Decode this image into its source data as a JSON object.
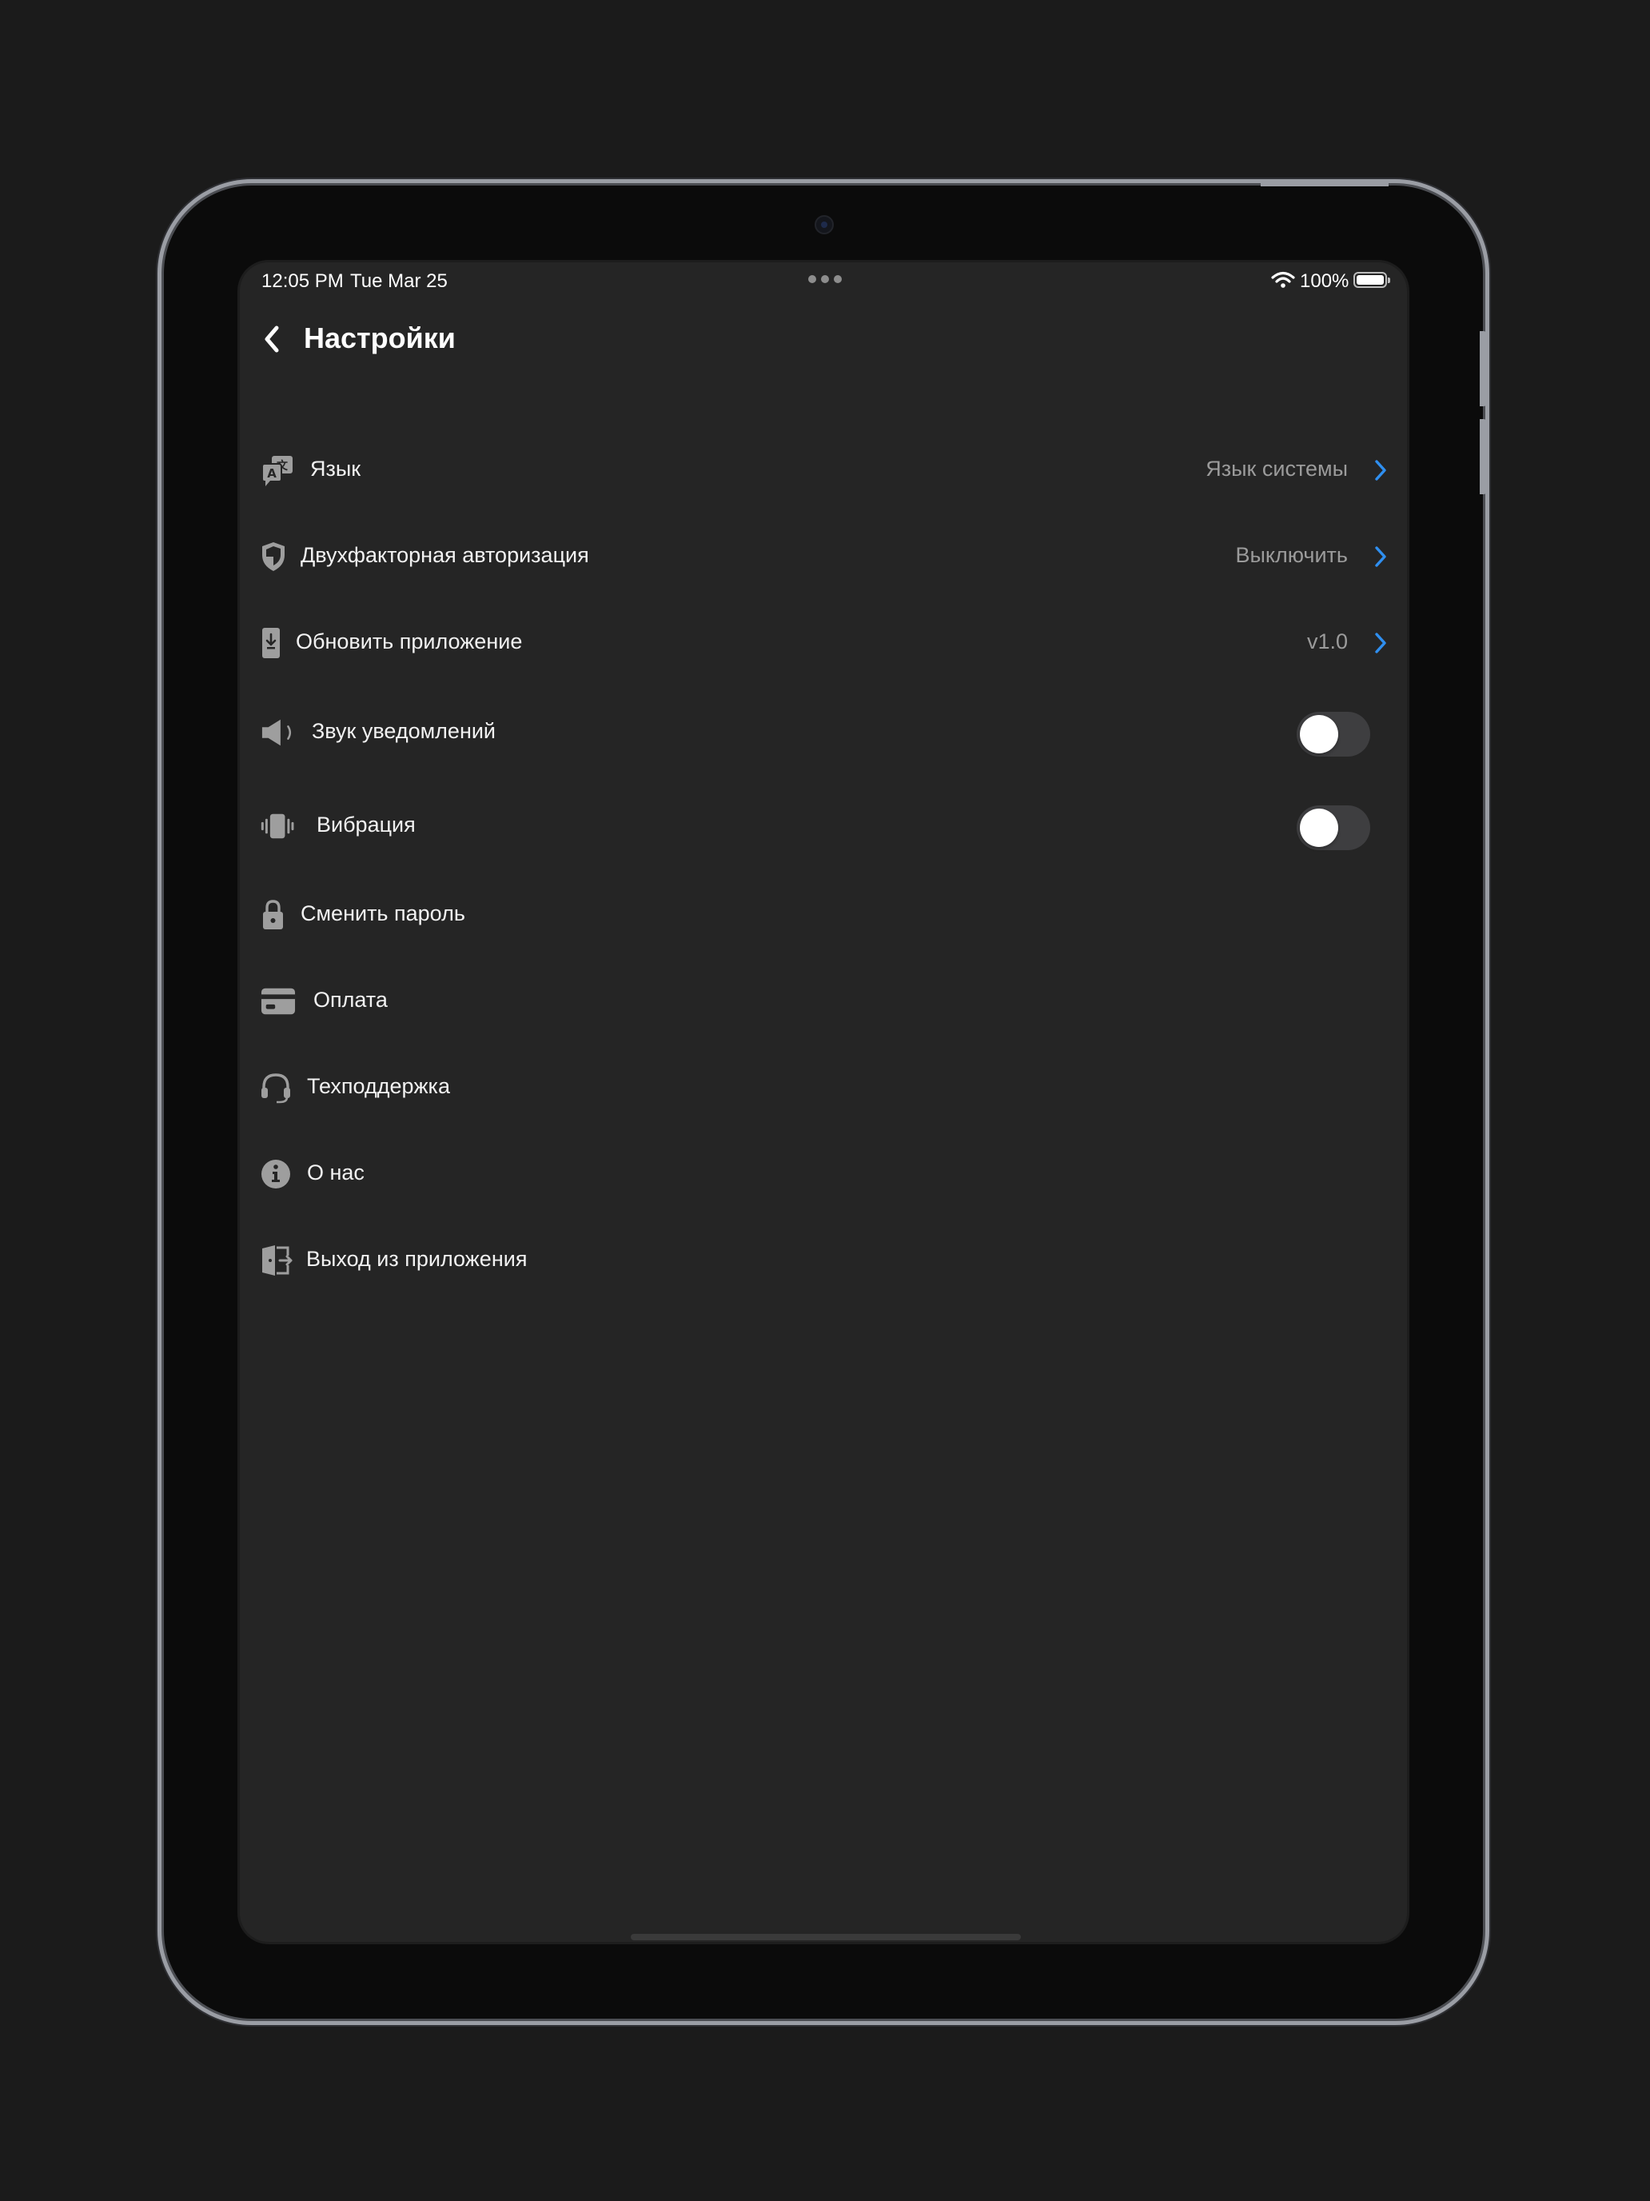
{
  "status_bar": {
    "time": "12:05 PM",
    "date": "Tue Mar 25",
    "battery": "100%"
  },
  "header": {
    "title": "Настройки"
  },
  "settings": {
    "language": {
      "label": "Язык",
      "value": "Язык системы",
      "icon": "language-icon"
    },
    "two_factor": {
      "label": "Двухфакторная авторизация",
      "value": "Выключить",
      "icon": "shield-icon"
    },
    "update": {
      "label": "Обновить приложение",
      "value": "v1.0",
      "icon": "phone-download-icon"
    },
    "sound": {
      "label": "Звук уведомлений",
      "enabled": false,
      "icon": "speaker-icon"
    },
    "vibration": {
      "label": "Вибрация",
      "enabled": false,
      "icon": "vibration-icon"
    },
    "password": {
      "label": "Сменить пароль",
      "icon": "lock-icon"
    },
    "payment": {
      "label": "Оплата",
      "icon": "credit-card-icon"
    },
    "support": {
      "label": "Техподдержка",
      "icon": "headset-icon"
    },
    "about": {
      "label": "О нас",
      "icon": "info-icon"
    },
    "logout": {
      "label": "Выход из приложения",
      "icon": "exit-icon"
    }
  },
  "colors": {
    "background": "#252525",
    "accent": "#2f8ff0",
    "secondary_text": "#9b9b9b",
    "icon": "#9e9e9e"
  }
}
